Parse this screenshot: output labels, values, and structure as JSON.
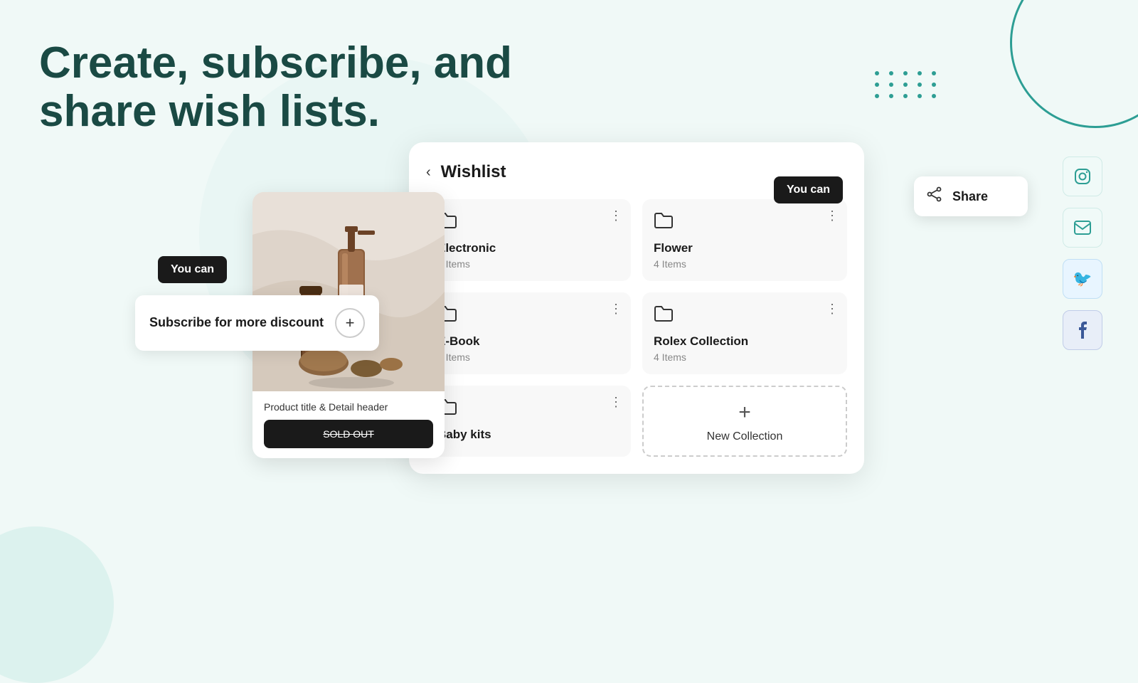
{
  "hero": {
    "title": "Create, subscribe, and share wish lists."
  },
  "product_card": {
    "title": "Product title & Detail header",
    "sold_out_label": "SOLD OUT"
  },
  "subscribe_tooltip": {
    "text": "Subscribe for more discount",
    "plus_label": "+"
  },
  "you_can_badge_left": {
    "label": "You can"
  },
  "you_can_badge_right": {
    "label": "You can"
  },
  "wishlist": {
    "title": "Wishlist",
    "back_label": "‹",
    "items": [
      {
        "name": "Electronic",
        "count": "4 Items",
        "has_more": true
      },
      {
        "name": "Flower",
        "count": "4 Items",
        "has_more": true
      },
      {
        "name": "E-Book",
        "count": "4 Items",
        "has_more": true
      },
      {
        "name": "Rolex Collection",
        "count": "4 Items",
        "has_more": true
      },
      {
        "name": "Baby kits",
        "count": "",
        "has_more": true
      }
    ],
    "new_collection_label": "New Collection",
    "new_plus": "+"
  },
  "share_dropdown": {
    "label": "Share"
  },
  "social": {
    "instagram_label": "Instagram",
    "email_label": "Email",
    "twitter_label": "Twitter",
    "facebook_label": "Facebook"
  }
}
